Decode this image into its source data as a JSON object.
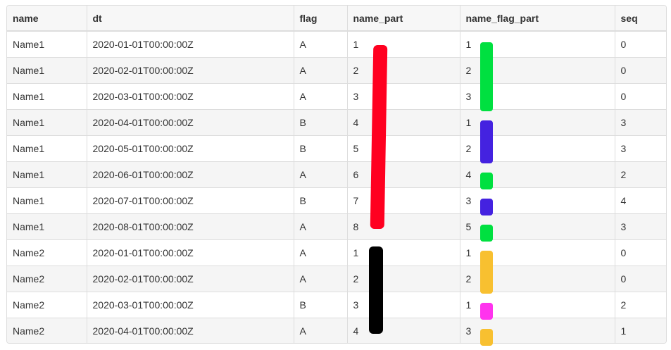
{
  "table": {
    "columns": [
      "name",
      "dt",
      "flag",
      "name_part",
      "name_flag_part",
      "seq"
    ],
    "rows": [
      [
        "Name1",
        "2020-01-01T00:00:00Z",
        "A",
        "1",
        "1",
        "0"
      ],
      [
        "Name1",
        "2020-02-01T00:00:00Z",
        "A",
        "2",
        "2",
        "0"
      ],
      [
        "Name1",
        "2020-03-01T00:00:00Z",
        "A",
        "3",
        "3",
        "0"
      ],
      [
        "Name1",
        "2020-04-01T00:00:00Z",
        "B",
        "4",
        "1",
        "3"
      ],
      [
        "Name1",
        "2020-05-01T00:00:00Z",
        "B",
        "5",
        "2",
        "3"
      ],
      [
        "Name1",
        "2020-06-01T00:00:00Z",
        "A",
        "6",
        "4",
        "2"
      ],
      [
        "Name1",
        "2020-07-01T00:00:00Z",
        "B",
        "7",
        "3",
        "4"
      ],
      [
        "Name1",
        "2020-08-01T00:00:00Z",
        "A",
        "8",
        "5",
        "3"
      ],
      [
        "Name2",
        "2020-01-01T00:00:00Z",
        "A",
        "1",
        "1",
        "0"
      ],
      [
        "Name2",
        "2020-02-01T00:00:00Z",
        "A",
        "2",
        "2",
        "0"
      ],
      [
        "Name2",
        "2020-03-01T00:00:00Z",
        "B",
        "3",
        "1",
        "2"
      ],
      [
        "Name2",
        "2020-04-01T00:00:00Z",
        "A",
        "4",
        "3",
        "1"
      ]
    ]
  },
  "annotations": {
    "name_part_group_colors": [
      "#ff0020",
      "#000000"
    ],
    "name_flag_part_colors": [
      "#00e040",
      "#00e040",
      "#00e040",
      "#4422e0",
      "#4422e0",
      "#00e040",
      "#4422e0",
      "#00e040",
      "#f8c030",
      "#f8c030",
      "#ff33ee",
      "#f8c030"
    ]
  }
}
